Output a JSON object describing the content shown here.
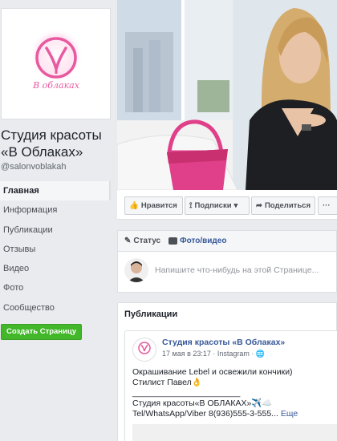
{
  "page": {
    "name": "Студия красоты «В Облаках»",
    "handle": "@salonvoblakah",
    "logo_text": "В облаках"
  },
  "nav": {
    "items": [
      {
        "label": "Главная",
        "active": true
      },
      {
        "label": "Информация"
      },
      {
        "label": "Публикации"
      },
      {
        "label": "Отзывы"
      },
      {
        "label": "Видео"
      },
      {
        "label": "Фото"
      },
      {
        "label": "Сообщество"
      }
    ],
    "create_page": "Создать Страницу"
  },
  "actions": {
    "like": "Нравится",
    "follow": "Подписки",
    "share": "Поделиться",
    "more": "···"
  },
  "composer": {
    "tab_status": "Статус",
    "tab_photo": "Фото/видео",
    "placeholder": "Напишите что-нибудь на этой Странице..."
  },
  "publications": {
    "title": "Публикации",
    "post": {
      "author": "Студия красоты «В Облаках»",
      "meta": "17 мая в 23:17 · Instagram ·",
      "line1": "Окрашивание Lebel и освежили кончики)",
      "line2": "Стилист Павел👌",
      "line3": "_______________________",
      "line4": "Студия красоты«В ОБЛАКАХ»✈️☁️",
      "line5": "Tel/WhatsApp/Viber 8(936)555-3-555...",
      "more": "Еще"
    }
  },
  "colors": {
    "brand_pink": "#e85aa0",
    "link_blue": "#365899",
    "green_button": "#42b72a",
    "background": "#e9ebee"
  }
}
